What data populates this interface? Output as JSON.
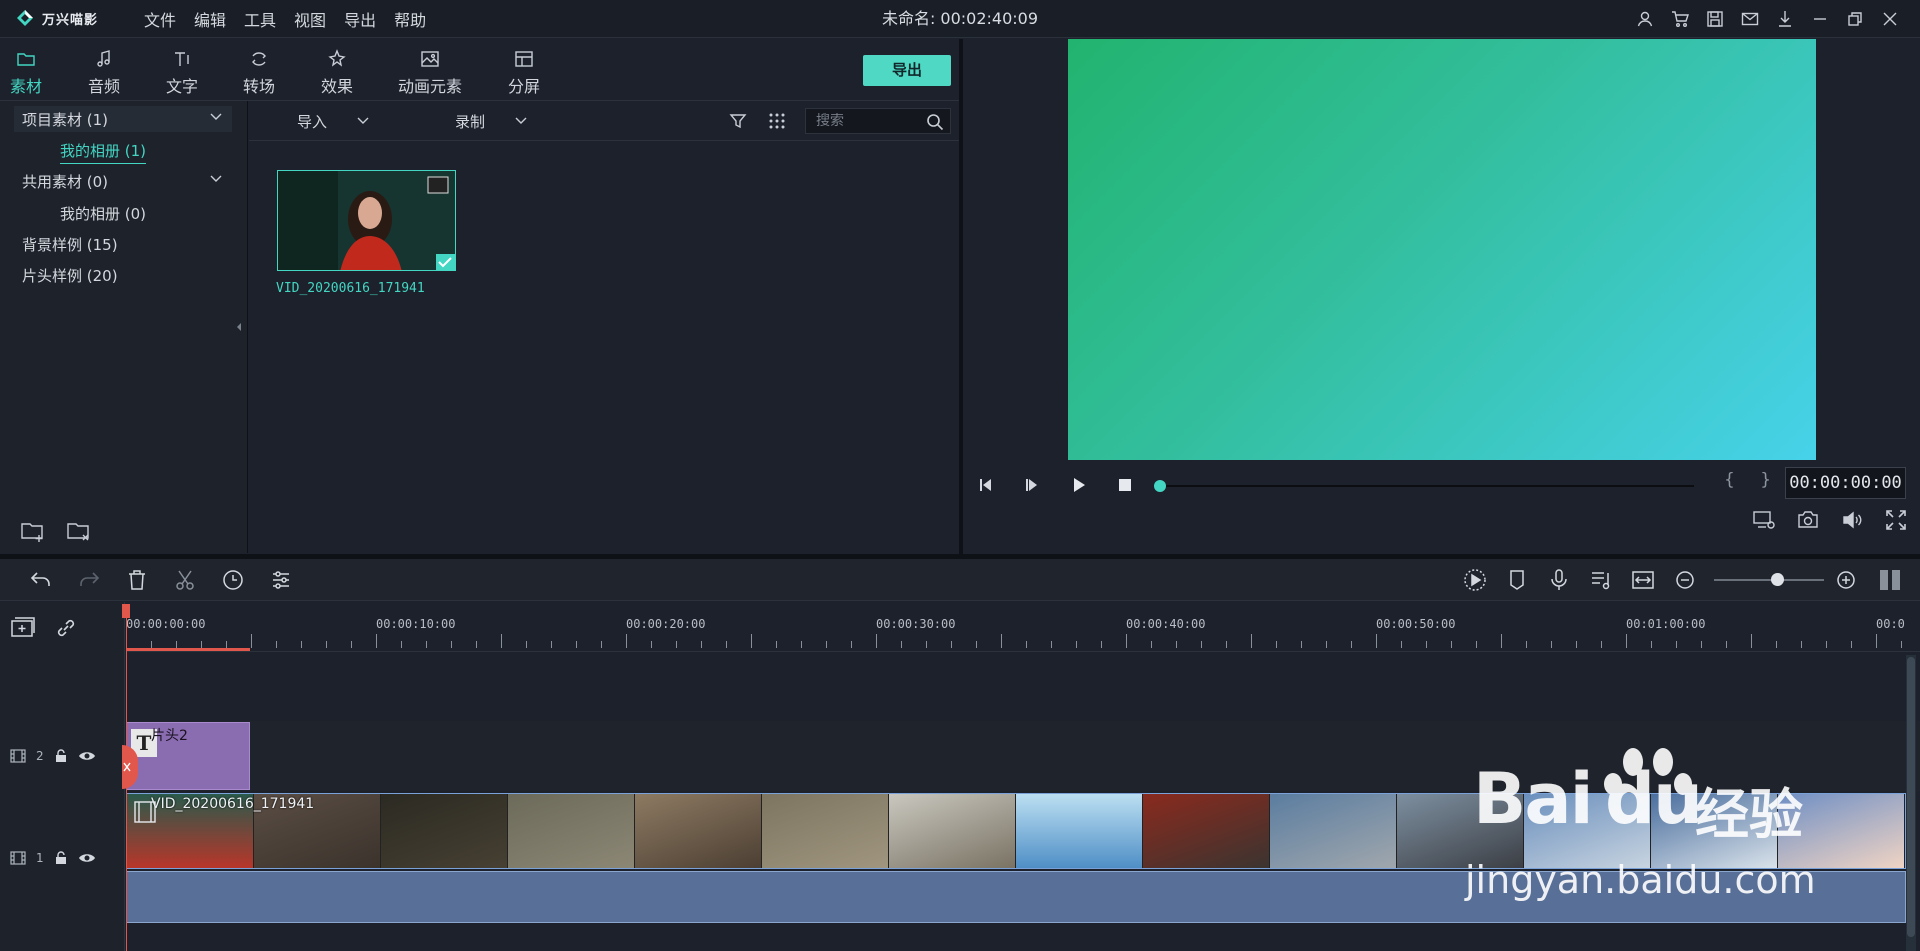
{
  "app": {
    "name": "万兴喵影",
    "doc_title": "未命名: 00:02:40:09"
  },
  "menu": [
    "文件",
    "编辑",
    "工具",
    "视图",
    "导出",
    "帮助"
  ],
  "tool_tabs": [
    {
      "label": "素材",
      "icon": "folder-icon"
    },
    {
      "label": "音频",
      "icon": "music-note-icon"
    },
    {
      "label": "文字",
      "icon": "text-icon"
    },
    {
      "label": "转场",
      "icon": "transition-icon"
    },
    {
      "label": "效果",
      "icon": "effects-icon"
    },
    {
      "label": "动画元素",
      "icon": "image-icon"
    },
    {
      "label": "分屏",
      "icon": "split-screen-icon"
    }
  ],
  "export_label": "导出",
  "library": {
    "items": [
      {
        "label": "项目素材 (1)"
      },
      {
        "label": "我的相册 (1)"
      },
      {
        "label": "共用素材 (0)"
      },
      {
        "label": "我的相册 (0)"
      },
      {
        "label": "背景样例 (15)"
      },
      {
        "label": "片头样例 (20)"
      }
    ]
  },
  "media_toolbar": {
    "import_label": "导入",
    "record_label": "录制",
    "search_placeholder": "搜索"
  },
  "media_items": [
    {
      "name": "VID_20200616_171941"
    }
  ],
  "player": {
    "timecode": "00:00:00:00",
    "brackets": "{ }"
  },
  "ruler_labels": [
    "00:00:00:00",
    "00:00:10:00",
    "00:00:20:00",
    "00:00:30:00",
    "00:00:40:00",
    "00:00:50:00",
    "00:01:00:00",
    "00:0"
  ],
  "tracks": [
    {
      "number": "2",
      "clip_label": "片头2"
    },
    {
      "number": "1",
      "clip_label": "VID_20200616_171941"
    }
  ],
  "watermark": {
    "brand": "Bai",
    "brand_mid": "du",
    "brand_cn": "经验",
    "url": "jingyan.baidu.com"
  },
  "colors": {
    "accent": "#43d6c3",
    "playhead": "#e2574c",
    "title_clip": "#8a6db0",
    "audio_clip": "#586f97"
  }
}
